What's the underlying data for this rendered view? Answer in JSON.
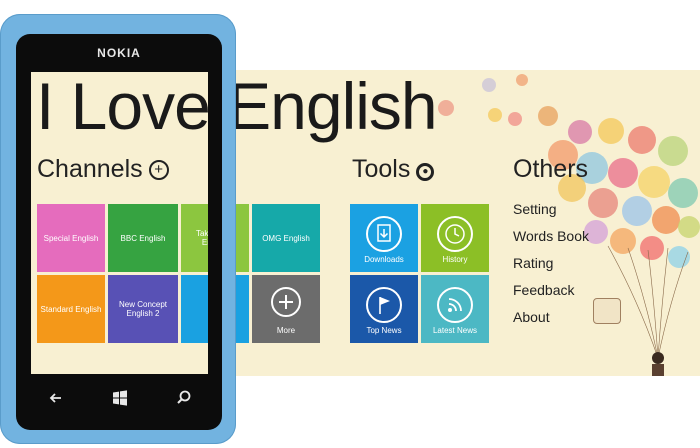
{
  "app_title": "I Love English",
  "channels": {
    "heading": "Channels",
    "tiles": [
      {
        "label": "Special English",
        "color": "#e56cbd"
      },
      {
        "label": "BBC English",
        "color": "#36a341"
      },
      {
        "label": "Take Away English",
        "color": "#8cc63f"
      },
      {
        "label": "OMG English",
        "color": "#16a9a9"
      },
      {
        "label": "Standard English",
        "color": "#f49819"
      },
      {
        "label": "New Concept English 2",
        "color": "#5851b5"
      },
      {
        "label": "",
        "color": "#1aa1e1"
      },
      {
        "label": "More",
        "color": "#6c6c6c"
      }
    ]
  },
  "tools": {
    "heading": "Tools",
    "tiles": [
      {
        "label": "Downloads",
        "color": "#1ba1e2",
        "icon": "download-icon"
      },
      {
        "label": "History",
        "color": "#8cbf26",
        "icon": "history-icon"
      },
      {
        "label": "Top News",
        "color": "#1b58a9",
        "icon": "flag-icon"
      },
      {
        "label": "Latest News",
        "color": "#4cb8c4",
        "icon": "rss-icon"
      }
    ]
  },
  "others": {
    "heading": "Others",
    "items": [
      "Setting",
      "Words Book",
      "Rating",
      "Feedback",
      "About"
    ]
  },
  "phone": {
    "brand": "NOKIA",
    "color": "#72b3e0"
  },
  "colors": {
    "background": "#f8f0d2"
  }
}
